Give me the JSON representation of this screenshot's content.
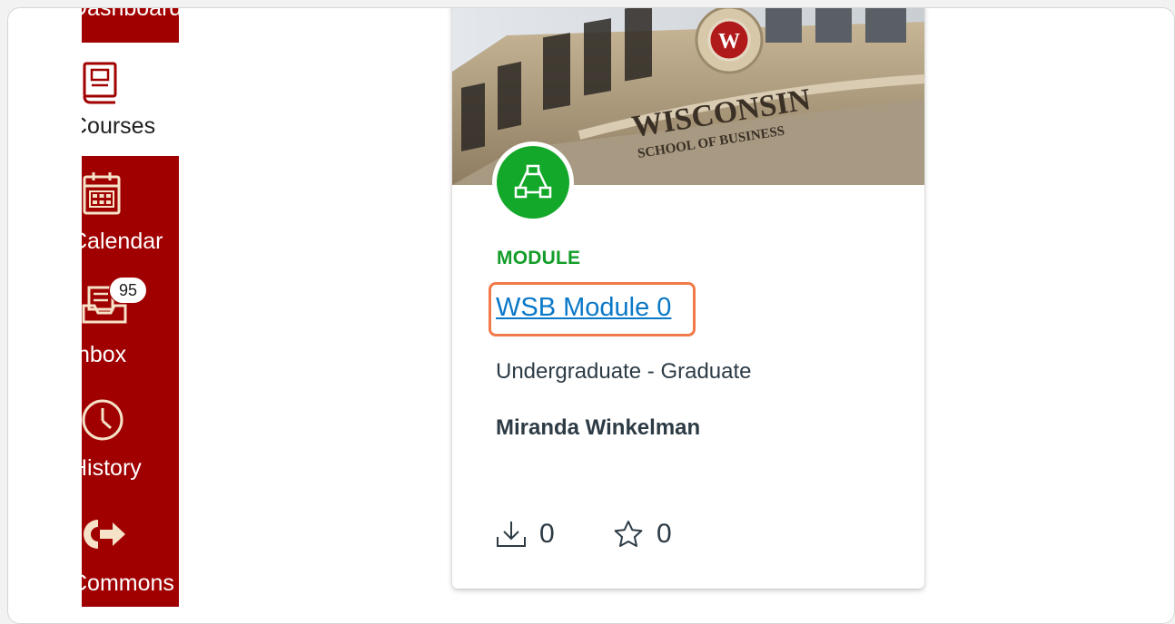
{
  "nav": {
    "items": [
      {
        "key": "dashboard",
        "label": "Dashboard",
        "icon": "dashboard-icon",
        "active": false
      },
      {
        "key": "courses",
        "label": "Courses",
        "icon": "courses-icon",
        "active": true
      },
      {
        "key": "calendar",
        "label": "Calendar",
        "icon": "calendar-icon",
        "active": false
      },
      {
        "key": "inbox",
        "label": "Inbox",
        "icon": "inbox-icon",
        "active": false,
        "badge": "95"
      },
      {
        "key": "history",
        "label": "History",
        "icon": "clock-icon",
        "active": false
      },
      {
        "key": "commons",
        "label": "Commons",
        "icon": "commons-icon",
        "active": false
      }
    ]
  },
  "card": {
    "banner_text_main": "WISCONSIN",
    "banner_text_sub": "SCHOOL OF BUSINESS",
    "type_icon": "module-icon",
    "type_label": "MODULE",
    "title": "WSB Module 0",
    "audience": "Undergraduate - Graduate",
    "author": "Miranda Winkelman",
    "downloads": "0",
    "favorites": "0"
  },
  "colors": {
    "nav_red": "#a00000",
    "module_green": "#14a82a",
    "link_blue": "#0a78c8",
    "highlight_orange": "#f07a4a"
  }
}
